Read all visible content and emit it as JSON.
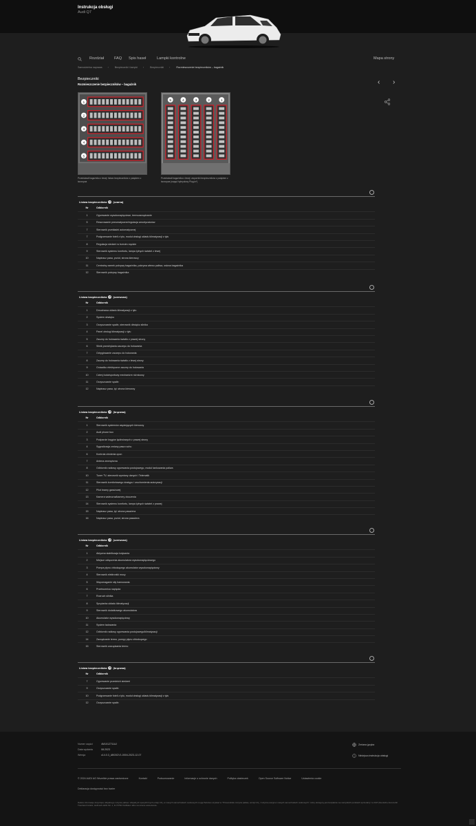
{
  "header": {
    "title": "Instrukcja obsługi",
    "model": "Audi Q7"
  },
  "nav": {
    "chapter": "Rozdział",
    "faq": "FAQ",
    "index": "Spis haseł",
    "lights": "Lampki kontrolne",
    "sitemap": "Mapa strony"
  },
  "breadcrumb": [
    "Samodzielna naprawa",
    "Bezpieczniki i lampki",
    "Bezpieczniki",
    "Rozmieszczenie bezpieczników – bagażnik"
  ],
  "section": "Bezpieczniki",
  "subtitle": "Rozmieszczenie bezpieczników – bagażnik",
  "images": {
    "left_caption": "Przedstawił bagażnika z lewej: listwa bezpieczników z paląkiem z tworzywa",
    "right_caption": "Przedstawił bagażnika z lewej: wsporniki bezpieczników z paląkiem z tworzywa (napęd hybrydowy Plug-in*)",
    "left_callouts": [
      "1",
      "2",
      "3",
      "4",
      "5"
    ],
    "right_callouts": [
      "5",
      "4",
      "3",
      "2",
      "1"
    ]
  },
  "col_nr": "Nr",
  "col_odb": "Odbiornik",
  "tables": [
    {
      "title": "Listwa bezpieczników",
      "num": "1",
      "color": "(czarna)",
      "rows": [
        [
          "1",
          "Ogrzewanie wysokonapięciowe, termozarządzanie"
        ],
        [
          "5",
          "Resorowanie pneumatyczne/regulacja amortyzatorów"
        ],
        [
          "7",
          "Sterownik przekładni automatycznej"
        ],
        [
          "7",
          "Podgrzewanie foteli z tyłu, moduł obsługi układu klimatyzacji z tyłu"
        ],
        [
          "8",
          "Regulacja siedzeń w trzecim rzędzie"
        ],
        [
          "9",
          "Sterownik systemu komfortu, lampa tylnych świateł z lewej"
        ],
        [
          "10",
          "Napinacz pasa, przód, strona kierowcy"
        ],
        [
          "11",
          "Centralny zamek pokrywy bagażnika, pokrywa wlewu paliwa, osłona bagażnika"
        ],
        [
          "12",
          "Sterownik pokrywy bagażnika"
        ]
      ]
    },
    {
      "title": "Listwa bezpieczników",
      "num": "2",
      "color": "(czerwona)",
      "rows": [
        [
          "1",
          "Dmuchawa układu klimatyzacji z tyłu"
        ],
        [
          "2",
          "System dźwięku"
        ],
        [
          "3",
          "Oczyszczanie spalin, sterownik dźwięku silnika"
        ],
        [
          "4",
          "Panel obsługi klimatyzacji z tyłu"
        ],
        [
          "5",
          "Zaczep do holowania światło z prawej strony"
        ],
        [
          "6",
          "Silnik przechylania zaczepu do holowania"
        ],
        [
          "7",
          "Odryglowanie zaczepu do holowania"
        ],
        [
          "8",
          "Zaczep do holowania światło z lewej strony"
        ],
        [
          "9",
          "Gniazdko elektryczne zaczep do holowania"
        ],
        [
          "10",
          "Czterý koła/sportowy mechanizm różnicowy"
        ],
        [
          "11",
          "Oczyszczanie spalin"
        ],
        [
          "12",
          "Napinacz pasa, tył, strona kierowcy"
        ]
      ]
    },
    {
      "title": "Listwa bezpieczników",
      "num": "3",
      "color": "(brązowa)",
      "rows": [
        [
          "1",
          "Sterownik systemów asystujących kierowcy"
        ],
        [
          "2",
          "Audi phone box"
        ],
        [
          "3",
          "Podparcie kręgów lędźwiowych z prawej strony"
        ],
        [
          "4",
          "Sygnalizacja zmiany pasa ruchu"
        ],
        [
          "6",
          "Kontrola ciśnienia opon"
        ],
        [
          "7",
          "Antena zewnętrzna"
        ],
        [
          "8",
          "Odbiornik radiowy ogrzewania postojowego, moduł tankowania paliwa"
        ],
        [
          "10",
          "Tuner TV, sterownik wymiany danych i Telematik"
        ],
        [
          "11",
          "Sterownik komfortowego dostępu i uruchomienia autoryzacji"
        ],
        [
          "12",
          "Pilot bramy garażowej"
        ],
        [
          "13",
          "Kamera wsteczna/kamery otoczenia"
        ],
        [
          "14",
          "Sterownik systemu komfortu, lampa tylnych świateł z prawej"
        ],
        [
          "15",
          "Napinacz pasa, tył, strona pasażera"
        ],
        [
          "16",
          "Napinacz pasa, przód, strona pasażera"
        ]
      ]
    },
    {
      "title": "Listwa bezpieczników",
      "num": "4",
      "color": "(czerwona)",
      "rows": [
        [
          "1",
          "Aktywna stabilizacja kołysania"
        ],
        [
          "2",
          "Miejsce odłączenia akumulatora wysokonapięciowego"
        ],
        [
          "3",
          "Pompa płynu chłodzącego akumulator wysokonapięciowy"
        ],
        [
          "4",
          "Sterownik elektroniki mocy"
        ],
        [
          "5",
          "Wspomaganie siły hamowania"
        ],
        [
          "6",
          "Przetwornica napięcia"
        ],
        [
          "7",
          "Rozruch silnika"
        ],
        [
          "8",
          "Sprężarka układu klimatyzacji"
        ],
        [
          "9",
          "Sterownik dodatkowego akumulatora"
        ],
        [
          "10",
          "Akumulator wysokonapięciowy"
        ],
        [
          "11",
          "System ładowania"
        ],
        [
          "12",
          "Odbiornik radiowy ogrzewania postojowego/klimatyzacji"
        ],
        [
          "14",
          "Zarządzanie termo, pompy płynu chłodzącego"
        ],
        [
          "15",
          "Sterownik zarządzania termo"
        ]
      ]
    },
    {
      "title": "Listwa bezpieczników",
      "num": "5",
      "color": "(brązowa)",
      "rows": [
        [
          "7",
          "Ogrzewanie przednich siedzeń"
        ],
        [
          "9",
          "Oczyszczanie spalin"
        ],
        [
          "10",
          "Podgrzewanie foteli z tyłu, moduł obsługi układu klimatyzacji z tyłu"
        ],
        [
          "12",
          "Oczyszczanie spalin"
        ]
      ]
    }
  ],
  "footer": {
    "k1": "Numer części",
    "v1": "4M1012711AJ",
    "k2": "Data wydania",
    "v2": "08.2023",
    "k3": "Wersja",
    "v3": "c14.0.3_AB03CV1-0004-2023-12-07",
    "lang": "Zmiana języka",
    "notice": "Niniejsza instrukcja obsługi",
    "links": [
      "© 2024 AUDI AG Wszelkie prawa zastrzeżone",
      "Kontakt",
      "Podsumowanie",
      "Informacje o ochronie danych",
      "Polityka ciasteczek",
      "Open Source Software Notice",
      "Ustawienia cookie"
    ],
    "accessibility": "Deklaracja dostępności bez barier",
    "fine": "Dalsze informacje dotyczące oficjalnego zużycia paliwa i oficjalnych specyficznych emisji CO₂ w nowych samochodach osobowych mogą Państwo uzyskać w \"Przewodniku zużycia paliwa, emisji CO₂ i zużycia energii w nowych samochodach osobowych\", który dostępny jest bezpłatnie we wszystkich punktach sprzedaży i w DAT (Deutsche Automobil Treuhand GmbH, Hellmuth-Hirth-Str. 1, D-73760 Ostfildern albo na stronie www.dat.de."
  }
}
